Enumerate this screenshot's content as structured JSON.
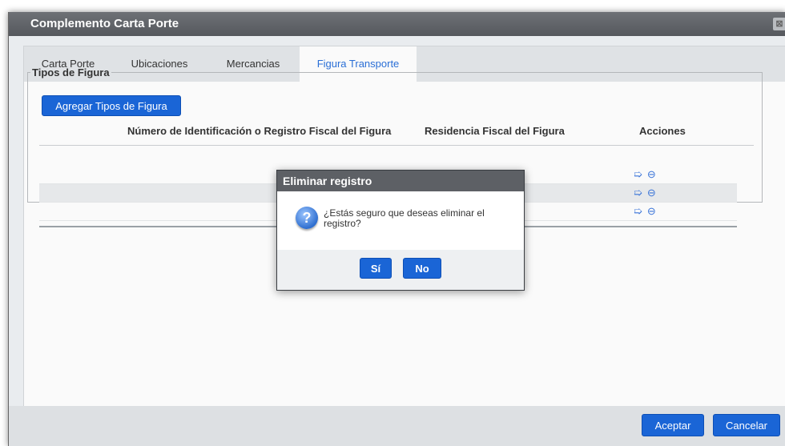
{
  "window": {
    "title": "Complemento Carta Porte",
    "close_glyph": "⊠"
  },
  "tabs": [
    {
      "label": "Carta Porte",
      "active": false
    },
    {
      "label": "Ubicaciones",
      "active": false
    },
    {
      "label": "Mercancias",
      "active": false
    },
    {
      "label": "Figura Transporte",
      "active": true
    }
  ],
  "group": {
    "legend": "Tipos de Figura",
    "add_button": "Agregar Tipos de Figura",
    "columns": [
      "Número de Identificación o Registro Fiscal del Figura",
      "Residencia Fiscal del Figura",
      "Acciones"
    ],
    "row_count_visible": 4
  },
  "footer": {
    "accept": "Aceptar",
    "cancel": "Cancelar"
  },
  "dialog": {
    "title": "Eliminar registro",
    "icon": "question-icon",
    "message": "¿Estás seguro que deseas eliminar el registro?",
    "yes": "Sí",
    "no": "No"
  },
  "colors": {
    "accent": "#1a65d6",
    "title_bar": "#5d6065",
    "active_tab_text": "#2a6fd6"
  }
}
